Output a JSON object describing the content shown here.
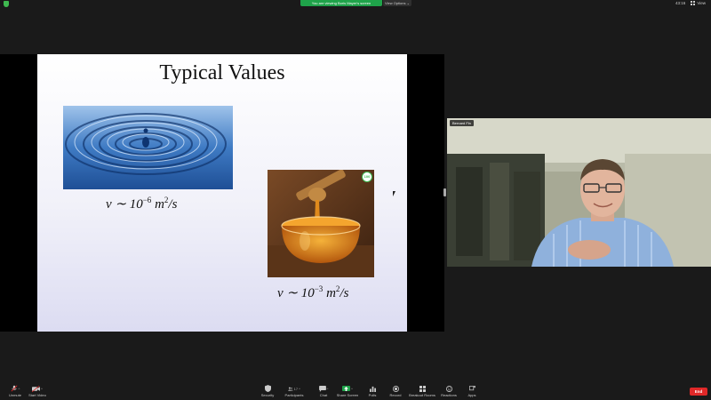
{
  "top_bar": {
    "viewing_text": "You are viewing Boris Mayer's screen",
    "view_options": "View Options ⌄",
    "timer": "43:16",
    "view_label": "View"
  },
  "slide": {
    "title": "Typical Values",
    "water_viscosity": {
      "prefix": "ν ∼ 10",
      "exp": "−6",
      "unit": " m",
      "unit_exp": "2",
      "tail": "/s"
    },
    "honey_viscosity": {
      "prefix": "ν ∼ 10",
      "exp": "−3",
      "unit": " m",
      "unit_exp": "2",
      "tail": "/s"
    },
    "badge": "100"
  },
  "participant": {
    "name": "Bernard Fin"
  },
  "toolbar": {
    "unmute": "Unmute",
    "start_video": "Start Video",
    "security": "Security",
    "participants": "Participants",
    "participants_count": "17",
    "chat": "Chat",
    "share_screen": "Share Screen",
    "polls": "Polls",
    "record": "Record",
    "breakout_rooms": "Breakout Rooms",
    "reactions": "Reactions",
    "apps": "Apps",
    "end": "End"
  },
  "colors": {
    "accent_green": "#1fa34a",
    "end_red": "#e02828",
    "toolbar_bg": "#1a1a1a"
  }
}
